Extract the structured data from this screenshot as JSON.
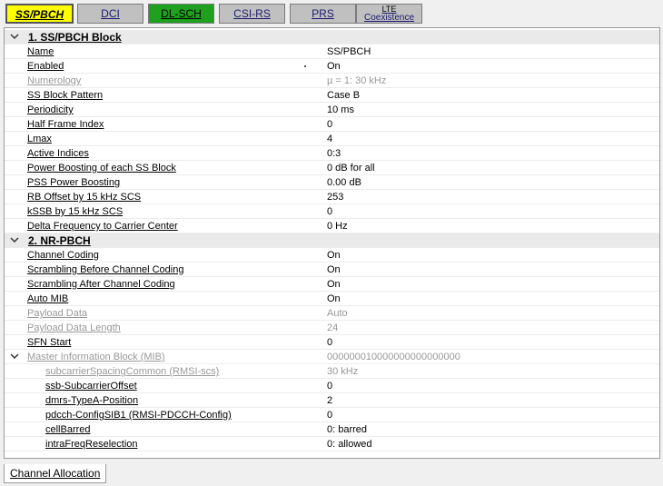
{
  "tabs": [
    {
      "label": "SS/PBCH"
    },
    {
      "label": "DCI"
    },
    {
      "label": "DL-SCH"
    },
    {
      "label": "CSI-RS"
    },
    {
      "label": "PRS"
    },
    {
      "label_top": "LTE",
      "label_bottom": "Coexistence"
    }
  ],
  "sections": [
    {
      "title": "1. SS/PBCH Block"
    },
    {
      "title": "2. NR-PBCH"
    }
  ],
  "params": [
    {
      "label": "Name",
      "value": "SS/PBCH"
    },
    {
      "label": "Enabled",
      "value": "On"
    },
    {
      "label": "Numerology",
      "value": "µ = 1: 30 kHz"
    },
    {
      "label": "SS Block Pattern",
      "value": "Case B"
    },
    {
      "label": "Periodicity",
      "value": "10 ms"
    },
    {
      "label": "Half Frame Index",
      "value": "0"
    },
    {
      "label": "Lmax",
      "value": "4"
    },
    {
      "label": "Active Indices",
      "value": "0:3"
    },
    {
      "label": "Power Boosting of each SS Block",
      "value": "0 dB for all"
    },
    {
      "label": "PSS Power Boosting",
      "value": "0.00 dB"
    },
    {
      "label": "RB Offset by 15 kHz SCS",
      "value": "253"
    },
    {
      "label": "kSSB by 15 kHz SCS",
      "value": "0"
    },
    {
      "label": "Delta Frequency to Carrier Center",
      "value": "0 Hz"
    },
    {
      "label": "Channel Coding",
      "value": "On"
    },
    {
      "label": "Scrambling Before Channel Coding",
      "value": "On"
    },
    {
      "label": "Scrambling After Channel Coding",
      "value": "On"
    },
    {
      "label": "Auto MIB",
      "value": "On"
    },
    {
      "label": "Payload Data",
      "value": "Auto"
    },
    {
      "label": "Payload Data Length",
      "value": "24"
    },
    {
      "label": "SFN Start",
      "value": "0"
    },
    {
      "label": "Master Information Block (MIB)",
      "value": "000000010000000000000000"
    },
    {
      "label": "subcarrierSpacingCommon (RMSI-scs)",
      "value": "30 kHz"
    },
    {
      "label": "ssb-SubcarrierOffset",
      "value": "0"
    },
    {
      "label": "dmrs-TypeA-Position",
      "value": "2"
    },
    {
      "label": "pdcch-ConfigSIB1 (RMSI-PDCCH-Config)",
      "value": "0"
    },
    {
      "label": "cellBarred",
      "value": "0: barred"
    },
    {
      "label": "intraFreqReselection",
      "value": "0: allowed"
    }
  ],
  "bottom_tab": {
    "label": "Channel Allocation"
  },
  "colors": {
    "active_tab": "#ffff00",
    "green_tab": "#1fa01f",
    "inactive_tab": "#c0c0c0",
    "disabled_text": "#999999"
  },
  "icons": {
    "collapse": "chevron-down-icon"
  }
}
